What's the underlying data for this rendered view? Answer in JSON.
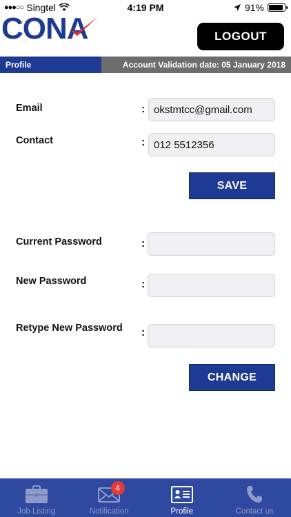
{
  "status_bar": {
    "carrier": "Singtel",
    "time": "4:19 PM",
    "battery": "91%",
    "battery_level": 0.91
  },
  "header": {
    "logo_text": "CONA",
    "logout_label": "LOGOUT"
  },
  "info_bar": {
    "section": "Profile",
    "validation": "Account Validation date: 05 January 2018"
  },
  "form": {
    "colon": ":",
    "email_label": "Email",
    "email_value": "okstmtcc@gmail.com",
    "contact_label": "Contact",
    "contact_value": "012 5512356",
    "save_label": "SAVE",
    "current_password_label": "Current Password",
    "new_password_label": "New Password",
    "retype_password_label": "Retype New Password",
    "change_label": "CHANGE"
  },
  "tabs": [
    {
      "label": "Job Listing",
      "icon": "briefcase-icon",
      "active": false
    },
    {
      "label": "Notification",
      "icon": "envelope-icon",
      "active": false,
      "badge": "4"
    },
    {
      "label": "Profile",
      "icon": "id-card-icon",
      "active": true
    },
    {
      "label": "Contact us",
      "icon": "phone-icon",
      "active": false
    }
  ],
  "colors": {
    "brand_blue": "#1f3a93",
    "tab_bar": "#2f48a0",
    "info_gray": "#6d6d6d",
    "badge_red": "#e53935",
    "logo_check_red": "#d32f2f"
  }
}
